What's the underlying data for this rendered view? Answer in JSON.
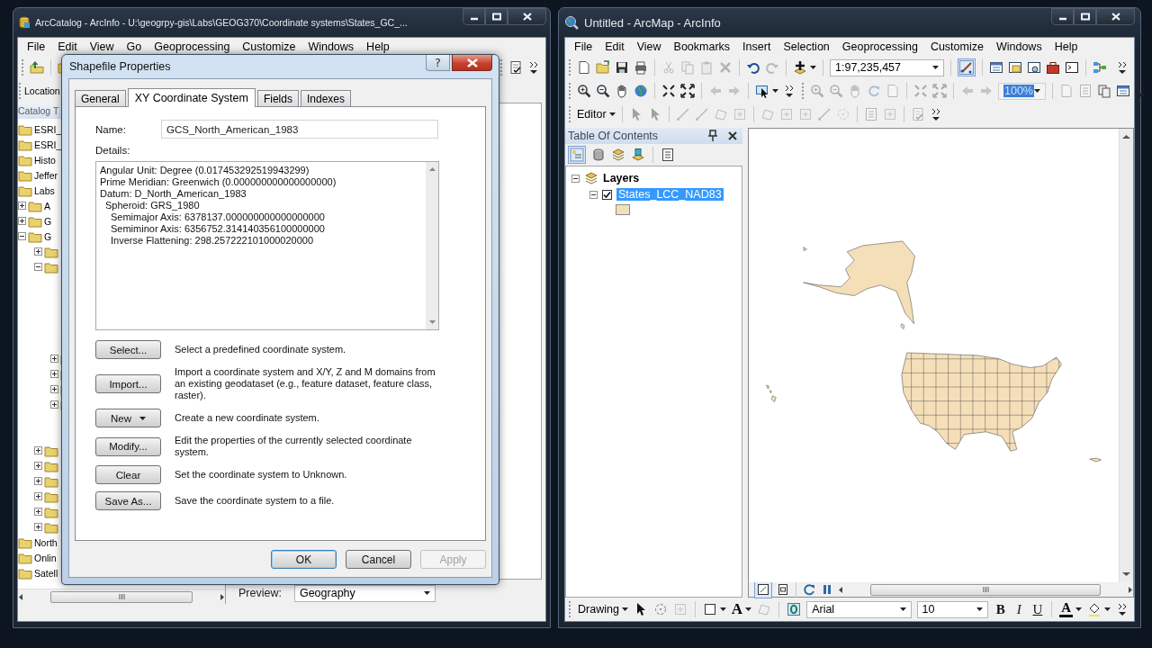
{
  "arccatalog": {
    "title": "ArcCatalog - ArcInfo - U:\\geogrpy-gis\\Labs\\GEOG370\\Coordinate systems\\States_GC_...",
    "menu": [
      "File",
      "Edit",
      "View",
      "Go",
      "Geoprocessing",
      "Customize",
      "Windows",
      "Help"
    ],
    "location_label": "Location",
    "catalog_tree": {
      "title": "Catalog T",
      "items": [
        {
          "label": "ESRI_"
        },
        {
          "label": "ESRI_"
        },
        {
          "label": "Histo"
        },
        {
          "label": "Jeffer"
        },
        {
          "label": "Labs",
          "children": [
            {
              "label": "A",
              "expanded": false
            },
            {
              "label": "G",
              "expanded": false
            },
            {
              "label": "G",
              "expanded": true,
              "children": [
                {
                  "expanded": false
                },
                {
                  "expanded": true,
                  "children": [
                    {
                      "expanded": false
                    },
                    {
                      "expanded": false
                    },
                    {
                      "expanded": false
                    },
                    {
                      "expanded": false
                    }
                  ]
                },
                {
                  "expanded": false
                },
                {
                  "expanded": false
                },
                {
                  "expanded": false
                },
                {
                  "expanded": false
                },
                {
                  "expanded": false
                },
                {
                  "expanded": false
                }
              ]
            }
          ]
        },
        {
          "label": "North"
        },
        {
          "label": "Onlin"
        },
        {
          "label": "Satell"
        }
      ]
    },
    "preview": {
      "label": "Preview:",
      "value": "Geography"
    }
  },
  "dialog": {
    "title": "Shapefile Properties",
    "help_glyph": "?",
    "tabs": [
      {
        "label": "General",
        "selected": false
      },
      {
        "label": "XY Coordinate System",
        "selected": true
      },
      {
        "label": "Fields",
        "selected": false
      },
      {
        "label": "Indexes",
        "selected": false
      }
    ],
    "name_field": {
      "label": "Name:",
      "value": "GCS_North_American_1983"
    },
    "details": {
      "label": "Details:",
      "lines": [
        {
          "text": "Angular Unit: Degree (0.017453292519943299)"
        },
        {
          "text": "Prime Meridian: Greenwich (0.000000000000000000)"
        },
        {
          "text": "Datum: D_North_American_1983",
          "children": [
            {
              "text": "Spheroid: GRS_1980",
              "children": [
                {
                  "text": "Semimajor Axis: 6378137.000000000000000000"
                },
                {
                  "text": "Semiminor Axis: 6356752.314140356100000000"
                },
                {
                  "text": "Inverse Flattening: 298.257222101000020000"
                }
              ]
            }
          ]
        }
      ]
    },
    "actions": [
      {
        "kind": "button",
        "button": "Select...",
        "description": "Select a predefined coordinate system."
      },
      {
        "kind": "button",
        "button": "Import...",
        "description": "Import a coordinate system and X/Y, Z and M domains from an existing geodataset (e.g., feature dataset, feature class, raster)."
      },
      {
        "kind": "menu",
        "button": "New",
        "description": "Create a new coordinate system."
      },
      {
        "kind": "button",
        "button": "Modify...",
        "description": "Edit the properties of the currently selected coordinate system."
      },
      {
        "kind": "button",
        "button": "Clear",
        "description": "Set the coordinate system to Unknown."
      },
      {
        "kind": "button",
        "button": "Save As...",
        "description": "Save the coordinate system to a file."
      }
    ],
    "buttons": [
      {
        "label": "OK",
        "default": true,
        "disabled": false
      },
      {
        "label": "Cancel",
        "default": false,
        "disabled": false
      },
      {
        "label": "Apply",
        "default": false,
        "disabled": true
      }
    ]
  },
  "arcmap": {
    "title": "Untitled - ArcMap - ArcInfo",
    "menu": [
      "File",
      "Edit",
      "View",
      "Bookmarks",
      "Insert",
      "Selection",
      "Geoprocessing",
      "Customize",
      "Windows",
      "Help"
    ],
    "scale": "1:97,235,457",
    "zoom_percent": "100%",
    "editor_menu": "Editor",
    "toc": {
      "title": "Table Of Contents",
      "layers": {
        "label": "Layers",
        "expanded": true,
        "children": [
          {
            "label": "States_LCC_NAD83",
            "checked": true,
            "selected": true,
            "expanded": true
          }
        ]
      }
    },
    "drawing_toolbar": {
      "menu": "Drawing",
      "text_tool": "A",
      "font": "Arial",
      "font_size": "10",
      "bold": "B",
      "italic": "I",
      "underline": "U",
      "font_color": "A"
    }
  }
}
